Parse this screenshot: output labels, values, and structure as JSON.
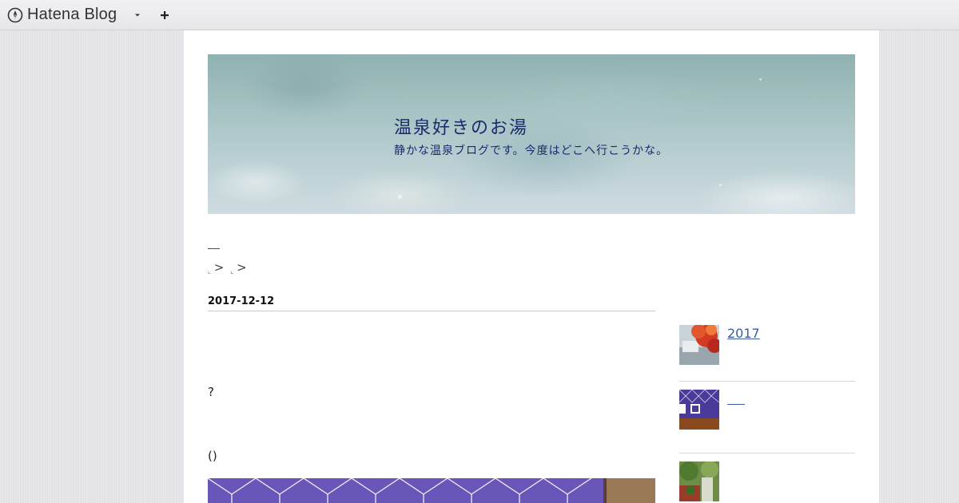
{
  "topbar": {
    "brand_label": "Hatena Blog",
    "brand_icon": "hatena-pen-icon",
    "dropdown_icon": "caret-down-icon",
    "add_icon": "plus-icon"
  },
  "blog": {
    "title": "温泉好きのお湯",
    "description": "静かな温泉ブログです。今度はどこへ行こうかな。"
  },
  "breadcrumb": {
    "separator": ">"
  },
  "article": {
    "date": "2017-12-12",
    "paragraph_1": "?",
    "paragraph_2": "()"
  },
  "sidebar": {
    "entries": [
      {
        "label": "2017",
        "thumb": "autumn-leaves-thumbnail"
      },
      {
        "label": "",
        "thumb": "onsen-noren-thumbnail"
      },
      {
        "label": "",
        "thumb": "garden-thumbnail"
      }
    ]
  },
  "colors": {
    "link": "#3a5ba0",
    "title_text": "#1b2a6b",
    "noren_purple": "#6a55b8"
  }
}
